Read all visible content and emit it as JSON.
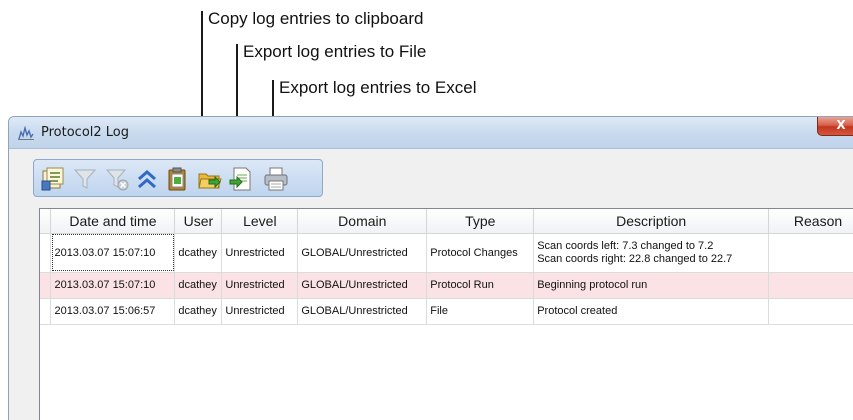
{
  "callouts": {
    "copy": "Copy log entries to clipboard",
    "export_file": "Export log entries to File",
    "export_excel": "Export log entries to Excel"
  },
  "window": {
    "title": "Protocol2 Log",
    "close_glyph": "X"
  },
  "toolbar": {
    "icons": [
      "columns-icon",
      "filter-icon",
      "clear-filter-icon",
      "collapse-icon",
      "copy-clipboard-icon",
      "export-file-icon",
      "export-excel-icon",
      "print-icon"
    ]
  },
  "grid": {
    "columns": [
      "Date and time",
      "User",
      "Level",
      "Domain",
      "Type",
      "Description",
      "Reason"
    ],
    "rows": [
      {
        "date": "2013.03.07 15:07:10",
        "user": "dcathey",
        "level": "Unrestricted",
        "domain": "GLOBAL/Unrestricted",
        "type": "Protocol Changes",
        "description": [
          "Scan coords left: 7.3 changed to 7.2",
          "Scan coords right: 22.8 changed to 22.7"
        ],
        "reason": ""
      },
      {
        "date": "2013.03.07 15:07:10",
        "user": "dcathey",
        "level": "Unrestricted",
        "domain": "GLOBAL/Unrestricted",
        "type": "Protocol Run",
        "description": [
          "Beginning protocol run"
        ],
        "reason": ""
      },
      {
        "date": "2013.03.07 15:06:57",
        "user": "dcathey",
        "level": "Unrestricted",
        "domain": "GLOBAL/Unrestricted",
        "type": "File",
        "description": [
          "Protocol created"
        ],
        "reason": ""
      }
    ]
  },
  "colors": {
    "selected_row": "#fbe3e5",
    "titlebar": "#c9dbef",
    "toolbar": "#bfd4ee"
  }
}
